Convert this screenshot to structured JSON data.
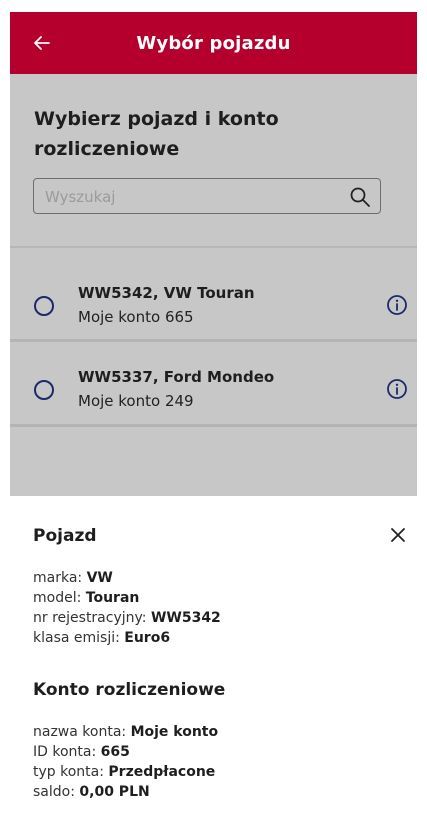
{
  "header": {
    "title": "Wybór pojazdu"
  },
  "main": {
    "heading": "Wybierz pojazd i konto rozliczeniowe",
    "search": {
      "placeholder": "Wyszukaj"
    },
    "vehicles": [
      {
        "name": "WW5342, VW Touran",
        "account": "Moje konto 665"
      },
      {
        "name": "WW5337, Ford Mondeo",
        "account": "Moje konto 249"
      }
    ]
  },
  "sheet": {
    "vehicle_title": "Pojazd",
    "vehicle_fields": [
      {
        "label": "marka: ",
        "value": "VW"
      },
      {
        "label": "model: ",
        "value": "Touran"
      },
      {
        "label": "nr rejestracyjny: ",
        "value": "WW5342"
      },
      {
        "label": "klasa emisji: ",
        "value": "Euro6"
      }
    ],
    "account_title": "Konto rozliczeniowe",
    "account_fields": [
      {
        "label": "nazwa konta: ",
        "value": "Moje konto"
      },
      {
        "label": "ID konta: ",
        "value": "665"
      },
      {
        "label": "typ konta: ",
        "value": "Przedpłacone"
      },
      {
        "label": "saldo: ",
        "value": "0,00 PLN"
      }
    ]
  },
  "colors": {
    "accent": "#b5002e",
    "radio": "#1b2a6b",
    "overlay": "#c7c7c7"
  },
  "icons": [
    "arrow-left-icon",
    "search-icon",
    "info-icon",
    "close-icon"
  ]
}
